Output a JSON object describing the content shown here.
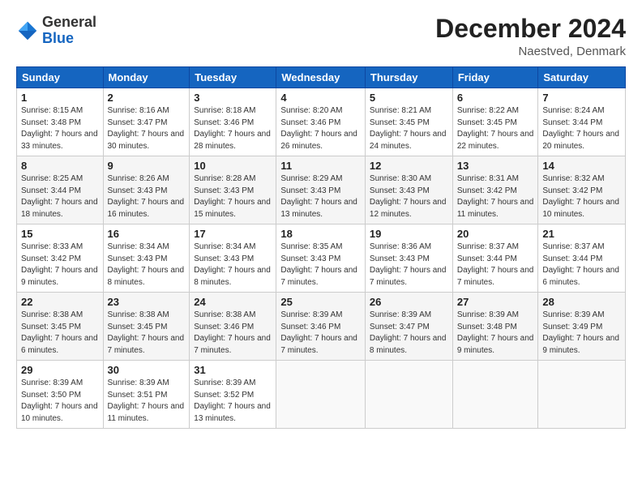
{
  "logo": {
    "general": "General",
    "blue": "Blue"
  },
  "header": {
    "month_title": "December 2024",
    "location": "Naestved, Denmark"
  },
  "days_of_week": [
    "Sunday",
    "Monday",
    "Tuesday",
    "Wednesday",
    "Thursday",
    "Friday",
    "Saturday"
  ],
  "weeks": [
    [
      {
        "day": "1",
        "sunrise": "Sunrise: 8:15 AM",
        "sunset": "Sunset: 3:48 PM",
        "daylight": "Daylight: 7 hours and 33 minutes."
      },
      {
        "day": "2",
        "sunrise": "Sunrise: 8:16 AM",
        "sunset": "Sunset: 3:47 PM",
        "daylight": "Daylight: 7 hours and 30 minutes."
      },
      {
        "day": "3",
        "sunrise": "Sunrise: 8:18 AM",
        "sunset": "Sunset: 3:46 PM",
        "daylight": "Daylight: 7 hours and 28 minutes."
      },
      {
        "day": "4",
        "sunrise": "Sunrise: 8:20 AM",
        "sunset": "Sunset: 3:46 PM",
        "daylight": "Daylight: 7 hours and 26 minutes."
      },
      {
        "day": "5",
        "sunrise": "Sunrise: 8:21 AM",
        "sunset": "Sunset: 3:45 PM",
        "daylight": "Daylight: 7 hours and 24 minutes."
      },
      {
        "day": "6",
        "sunrise": "Sunrise: 8:22 AM",
        "sunset": "Sunset: 3:45 PM",
        "daylight": "Daylight: 7 hours and 22 minutes."
      },
      {
        "day": "7",
        "sunrise": "Sunrise: 8:24 AM",
        "sunset": "Sunset: 3:44 PM",
        "daylight": "Daylight: 7 hours and 20 minutes."
      }
    ],
    [
      {
        "day": "8",
        "sunrise": "Sunrise: 8:25 AM",
        "sunset": "Sunset: 3:44 PM",
        "daylight": "Daylight: 7 hours and 18 minutes."
      },
      {
        "day": "9",
        "sunrise": "Sunrise: 8:26 AM",
        "sunset": "Sunset: 3:43 PM",
        "daylight": "Daylight: 7 hours and 16 minutes."
      },
      {
        "day": "10",
        "sunrise": "Sunrise: 8:28 AM",
        "sunset": "Sunset: 3:43 PM",
        "daylight": "Daylight: 7 hours and 15 minutes."
      },
      {
        "day": "11",
        "sunrise": "Sunrise: 8:29 AM",
        "sunset": "Sunset: 3:43 PM",
        "daylight": "Daylight: 7 hours and 13 minutes."
      },
      {
        "day": "12",
        "sunrise": "Sunrise: 8:30 AM",
        "sunset": "Sunset: 3:43 PM",
        "daylight": "Daylight: 7 hours and 12 minutes."
      },
      {
        "day": "13",
        "sunrise": "Sunrise: 8:31 AM",
        "sunset": "Sunset: 3:42 PM",
        "daylight": "Daylight: 7 hours and 11 minutes."
      },
      {
        "day": "14",
        "sunrise": "Sunrise: 8:32 AM",
        "sunset": "Sunset: 3:42 PM",
        "daylight": "Daylight: 7 hours and 10 minutes."
      }
    ],
    [
      {
        "day": "15",
        "sunrise": "Sunrise: 8:33 AM",
        "sunset": "Sunset: 3:42 PM",
        "daylight": "Daylight: 7 hours and 9 minutes."
      },
      {
        "day": "16",
        "sunrise": "Sunrise: 8:34 AM",
        "sunset": "Sunset: 3:43 PM",
        "daylight": "Daylight: 7 hours and 8 minutes."
      },
      {
        "day": "17",
        "sunrise": "Sunrise: 8:34 AM",
        "sunset": "Sunset: 3:43 PM",
        "daylight": "Daylight: 7 hours and 8 minutes."
      },
      {
        "day": "18",
        "sunrise": "Sunrise: 8:35 AM",
        "sunset": "Sunset: 3:43 PM",
        "daylight": "Daylight: 7 hours and 7 minutes."
      },
      {
        "day": "19",
        "sunrise": "Sunrise: 8:36 AM",
        "sunset": "Sunset: 3:43 PM",
        "daylight": "Daylight: 7 hours and 7 minutes."
      },
      {
        "day": "20",
        "sunrise": "Sunrise: 8:37 AM",
        "sunset": "Sunset: 3:44 PM",
        "daylight": "Daylight: 7 hours and 7 minutes."
      },
      {
        "day": "21",
        "sunrise": "Sunrise: 8:37 AM",
        "sunset": "Sunset: 3:44 PM",
        "daylight": "Daylight: 7 hours and 6 minutes."
      }
    ],
    [
      {
        "day": "22",
        "sunrise": "Sunrise: 8:38 AM",
        "sunset": "Sunset: 3:45 PM",
        "daylight": "Daylight: 7 hours and 6 minutes."
      },
      {
        "day": "23",
        "sunrise": "Sunrise: 8:38 AM",
        "sunset": "Sunset: 3:45 PM",
        "daylight": "Daylight: 7 hours and 7 minutes."
      },
      {
        "day": "24",
        "sunrise": "Sunrise: 8:38 AM",
        "sunset": "Sunset: 3:46 PM",
        "daylight": "Daylight: 7 hours and 7 minutes."
      },
      {
        "day": "25",
        "sunrise": "Sunrise: 8:39 AM",
        "sunset": "Sunset: 3:46 PM",
        "daylight": "Daylight: 7 hours and 7 minutes."
      },
      {
        "day": "26",
        "sunrise": "Sunrise: 8:39 AM",
        "sunset": "Sunset: 3:47 PM",
        "daylight": "Daylight: 7 hours and 8 minutes."
      },
      {
        "day": "27",
        "sunrise": "Sunrise: 8:39 AM",
        "sunset": "Sunset: 3:48 PM",
        "daylight": "Daylight: 7 hours and 9 minutes."
      },
      {
        "day": "28",
        "sunrise": "Sunrise: 8:39 AM",
        "sunset": "Sunset: 3:49 PM",
        "daylight": "Daylight: 7 hours and 9 minutes."
      }
    ],
    [
      {
        "day": "29",
        "sunrise": "Sunrise: 8:39 AM",
        "sunset": "Sunset: 3:50 PM",
        "daylight": "Daylight: 7 hours and 10 minutes."
      },
      {
        "day": "30",
        "sunrise": "Sunrise: 8:39 AM",
        "sunset": "Sunset: 3:51 PM",
        "daylight": "Daylight: 7 hours and 11 minutes."
      },
      {
        "day": "31",
        "sunrise": "Sunrise: 8:39 AM",
        "sunset": "Sunset: 3:52 PM",
        "daylight": "Daylight: 7 hours and 13 minutes."
      },
      null,
      null,
      null,
      null
    ]
  ]
}
